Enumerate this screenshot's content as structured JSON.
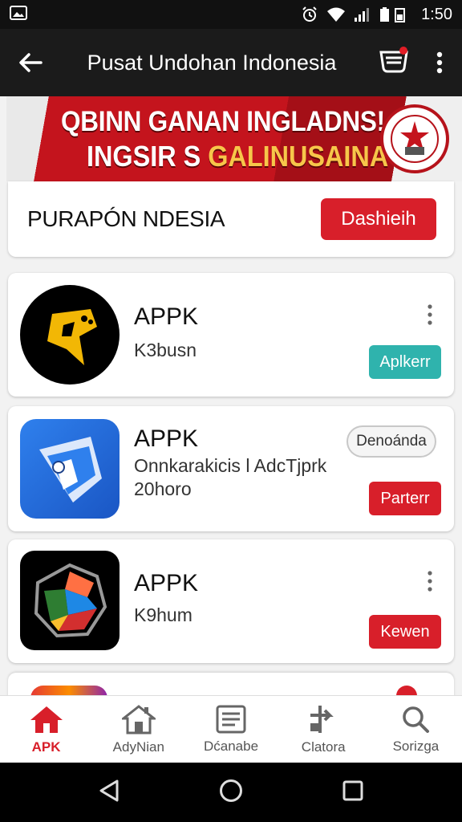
{
  "status_bar": {
    "time": "1:50"
  },
  "app_bar": {
    "title": "Pusat Undohan Indonesia"
  },
  "banner": {
    "line1": "QBINN GANAN INGLADNS!",
    "line2_prefix": "INGSIR S ",
    "line2_highlight": "GALINUSAINA"
  },
  "header": {
    "label": "PURAPÓN NDESIA",
    "button": "Dashieih"
  },
  "apps": [
    {
      "name": "APPK",
      "subtitle": "K3busn",
      "button": "Aplkerr",
      "button_color": "#2fb3ad"
    },
    {
      "name": "APPK",
      "subtitle": "Onnkarakicis l AdcTjprk",
      "subtitle2": "20horo",
      "badge": "Denoánda",
      "button": "Parterr",
      "button_color": "#d81f2a"
    },
    {
      "name": "APPK",
      "subtitle": "K9hum",
      "button": "Kewen",
      "button_color": "#d81f2a"
    }
  ],
  "bottom_nav": [
    {
      "label": "APK",
      "icon": "home-icon",
      "active": true
    },
    {
      "label": "AdyNian",
      "icon": "store-icon",
      "active": false
    },
    {
      "label": "Dćanabe",
      "icon": "list-icon",
      "active": false
    },
    {
      "label": "Clatora",
      "icon": "transfer-icon",
      "active": false
    },
    {
      "label": "Sorizga",
      "icon": "search-icon",
      "active": false
    }
  ],
  "colors": {
    "accent": "#d81f2a",
    "teal": "#2fb3ad",
    "app_bar": "#1b1b1b"
  }
}
